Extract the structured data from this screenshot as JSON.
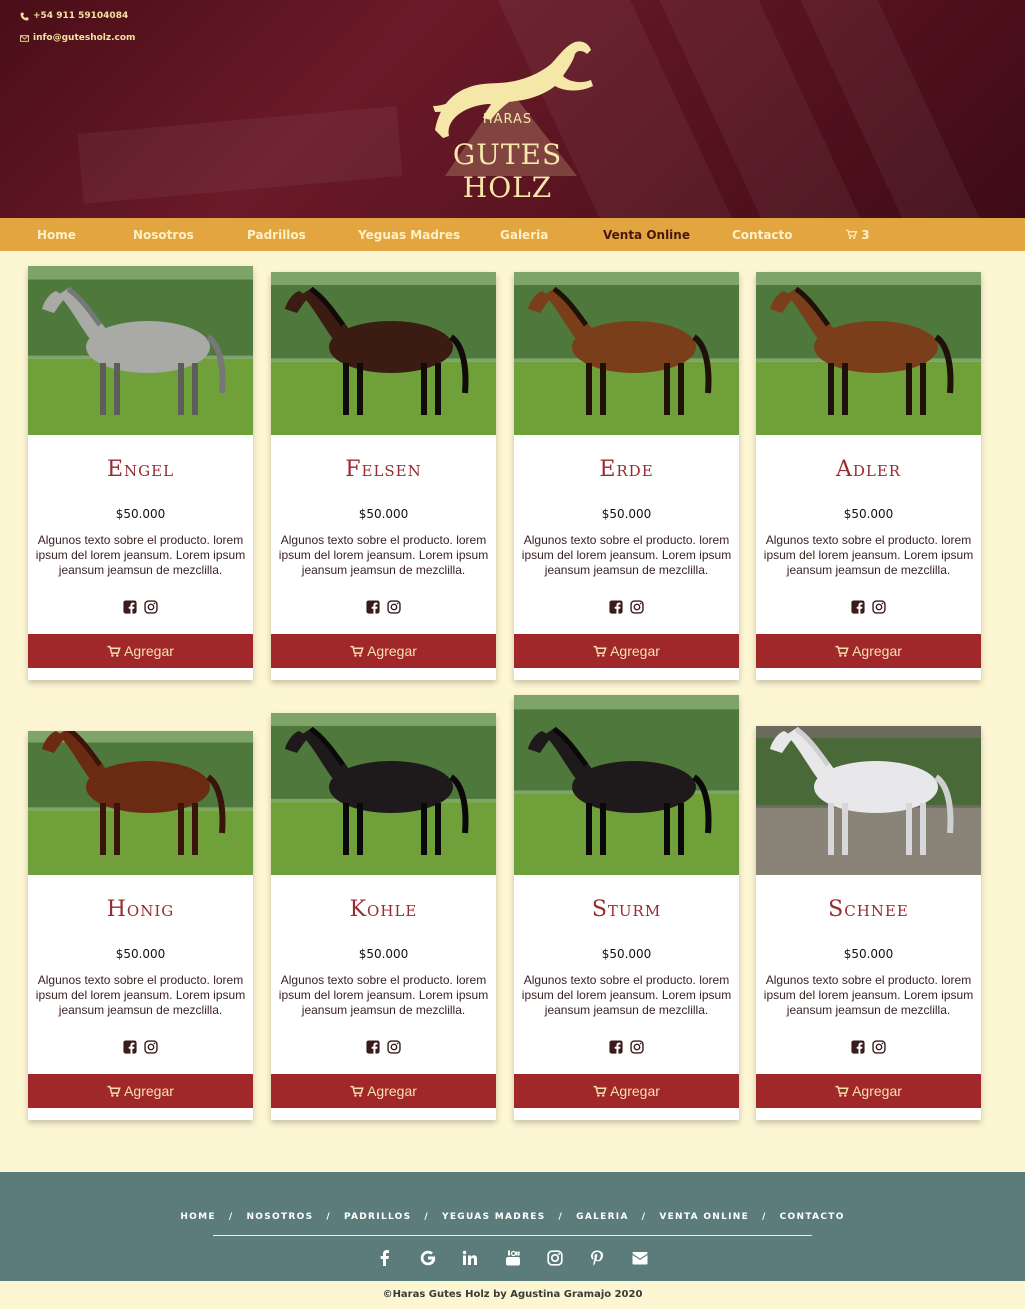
{
  "header": {
    "phone": "+54 911 59104084",
    "email": "info@gutesholz.com",
    "logo_top": "HARAS",
    "logo_name": "GUTES HOLZ"
  },
  "nav": {
    "items": [
      "Home",
      "Nosotros",
      "Padrillos",
      "Yeguas Madres",
      "Galeria",
      "Venta Online",
      "Contacto"
    ],
    "active": "Venta Online",
    "cart_count": "3"
  },
  "products": [
    {
      "name": "Engel",
      "price": "$50.000",
      "description": "Algunos texto sobre el producto. lorem ipsum del lorem jeansum. Lorem ipsum jeansum jeamsun de mezclilla.",
      "button": "Agregar",
      "coat": "dapple-grey"
    },
    {
      "name": "Felsen",
      "price": "$50.000",
      "description": "Algunos texto sobre el producto. lorem ipsum del lorem jeansum. Lorem ipsum jeansum jeamsun de mezclilla.",
      "button": "Agregar",
      "coat": "dark-bay"
    },
    {
      "name": "Erde",
      "price": "$50.000",
      "description": "Algunos texto sobre el producto. lorem ipsum del lorem jeansum. Lorem ipsum jeansum jeamsun de mezclilla.",
      "button": "Agregar",
      "coat": "bay"
    },
    {
      "name": "Adler",
      "price": "$50.000",
      "description": "Algunos texto sobre el producto. lorem ipsum del lorem jeansum. Lorem ipsum jeansum jeamsun de mezclilla.",
      "button": "Agregar",
      "coat": "bay"
    },
    {
      "name": "Honig",
      "price": "$50.000",
      "description": "Algunos texto sobre el producto. lorem ipsum del lorem jeansum. Lorem ipsum jeansum jeamsun de mezclilla.",
      "button": "Agregar",
      "coat": "chestnut"
    },
    {
      "name": "Kohle",
      "price": "$50.000",
      "description": "Algunos texto sobre el producto. lorem ipsum del lorem jeansum. Lorem ipsum jeansum jeamsun de mezclilla.",
      "button": "Agregar",
      "coat": "black"
    },
    {
      "name": "Sturm",
      "price": "$50.000",
      "description": "Algunos texto sobre el producto. lorem ipsum del lorem jeansum. Lorem ipsum jeansum jeamsun de mezclilla.",
      "button": "Agregar",
      "coat": "black"
    },
    {
      "name": "Schnee",
      "price": "$50.000",
      "description": "Algunos texto sobre el producto. lorem ipsum del lorem jeansum. Lorem ipsum jeansum jeamsun de mezclilla.",
      "button": "Agregar",
      "coat": "white"
    }
  ],
  "footer": {
    "nav": [
      "HOME",
      "NOSOTROS",
      "PADRILLOS",
      "YEGUAS MADRES",
      "GALERIA",
      "VENTA ONLINE",
      "CONTACTO"
    ],
    "separator": "/",
    "social_icons": [
      "facebook-icon",
      "google-icon",
      "linkedin-icon",
      "youtube-icon",
      "instagram-icon",
      "pinterest-icon",
      "envelope-icon"
    ],
    "copyright": "©Haras Gutes Holz by Agustina Gramajo 2020"
  },
  "colors": {
    "header_bg": "#5b1421",
    "nav_bg": "#e2a540",
    "page_bg": "#fdf6d3",
    "accent_red": "#a0282b",
    "footer_bg": "#5c7c7b",
    "logo_gold": "#f5e7a8"
  }
}
